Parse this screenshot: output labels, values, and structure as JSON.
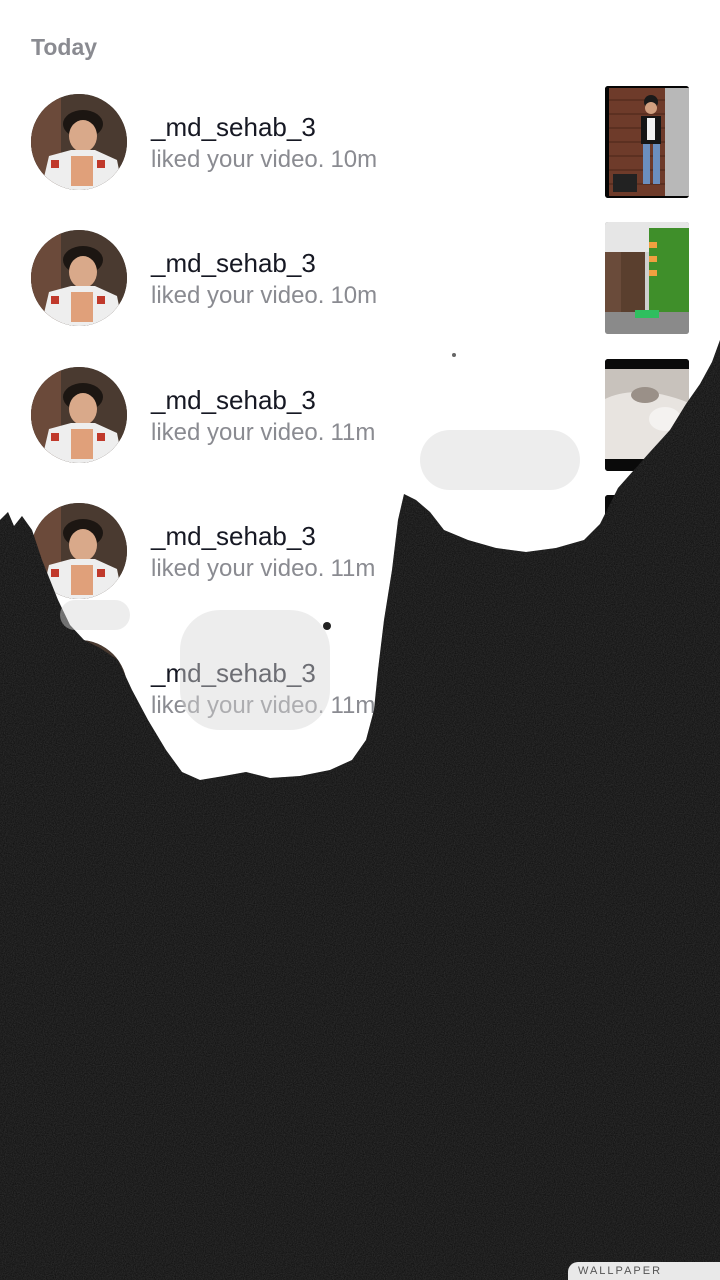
{
  "section": {
    "title": "Today"
  },
  "notifications": [
    {
      "username": "_md_sehab_3",
      "action": "liked your video.",
      "time": "10m",
      "thumb": "thumb-street-photo"
    },
    {
      "username": "_md_sehab_3",
      "action": "liked your video.",
      "time": "10m",
      "thumb": "thumb-room-photo"
    },
    {
      "username": "_md_sehab_3",
      "action": "liked your video.",
      "time": "11m",
      "thumb": "thumb-bed-photo"
    },
    {
      "username": "_md_sehab_3",
      "action": "liked your video.",
      "time": "11m",
      "thumb": "thumb-dark"
    },
    {
      "username": "_md_sehab_3",
      "action": "liked your video.",
      "time": "11m",
      "thumb": "thumb-hidden"
    }
  ],
  "watermark": {
    "text": "WALLPAPER"
  },
  "colors": {
    "text_primary": "#161823",
    "text_secondary": "#8a8b91",
    "overlay": "#0b0b0b"
  }
}
